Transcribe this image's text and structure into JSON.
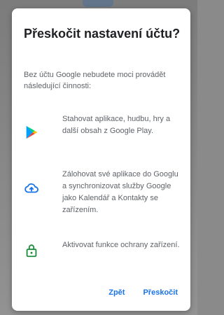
{
  "dialog": {
    "title": "Přeskočit nastavení účtu?",
    "intro": "Bez účtu Google nebudete moci provádět následující činnosti:",
    "features": [
      {
        "icon": "google-play-icon",
        "text": "Stahovat aplikace, hudbu, hry a další obsah z Google Play."
      },
      {
        "icon": "cloud-backup-icon",
        "text": "Zálohovat své aplikace do Googlu a synchronizovat služby Google jako Kalendář a Kontakty se zařízením."
      },
      {
        "icon": "lock-icon",
        "text": "Aktivovat funkce ochrany zařízení."
      }
    ],
    "back_label": "Zpět",
    "skip_label": "Přeskočit"
  },
  "colors": {
    "accent": "#1a73e8",
    "security_green": "#1e8e3e"
  }
}
